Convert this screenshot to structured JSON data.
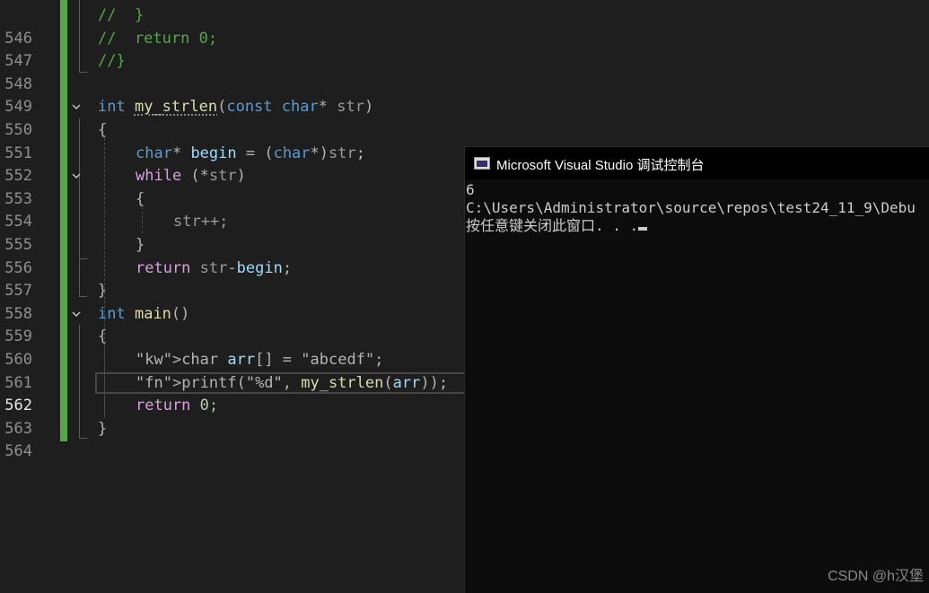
{
  "editor": {
    "current_line": "562",
    "lines": [
      {
        "no": "546",
        "text": "//  }"
      },
      {
        "no": "547",
        "text": "//  return 0;"
      },
      {
        "no": "548",
        "text": "//}"
      },
      {
        "no": "549",
        "text": ""
      },
      {
        "no": "550",
        "text": "int my_strlen(const char* str)"
      },
      {
        "no": "551",
        "text": "{"
      },
      {
        "no": "552",
        "text": "char* begin = (char*)str;"
      },
      {
        "no": "553",
        "text": "while (*str)"
      },
      {
        "no": "554",
        "text": "{"
      },
      {
        "no": "555",
        "text": "str++;"
      },
      {
        "no": "556",
        "text": "}"
      },
      {
        "no": "557",
        "text": "return str-begin;"
      },
      {
        "no": "558",
        "text": "}"
      },
      {
        "no": "559",
        "text": "int main()"
      },
      {
        "no": "560",
        "text": "{"
      },
      {
        "no": "561",
        "text": "char arr[] = \"abcedf\";"
      },
      {
        "no": "562",
        "text": "printf(\"%d\", my_strlen(arr));"
      },
      {
        "no": "563",
        "text": "return 0;"
      },
      {
        "no": "564",
        "text": "}"
      }
    ]
  },
  "console": {
    "title": "Microsoft Visual Studio 调试控制台",
    "icon": "console-app-icon",
    "output": [
      "6",
      "C:\\Users\\Administrator\\source\\repos\\test24_11_9\\Debu",
      "按任意键关闭此窗口. . ."
    ]
  },
  "watermark": "CSDN @h汉堡",
  "colors": {
    "background": "#1e1e1e",
    "keyword": "#569cd6",
    "control": "#d8a0df",
    "function": "#dcdcaa",
    "string": "#d69d85",
    "comment": "#57a64a",
    "console_bg": "#0c0c0c"
  }
}
